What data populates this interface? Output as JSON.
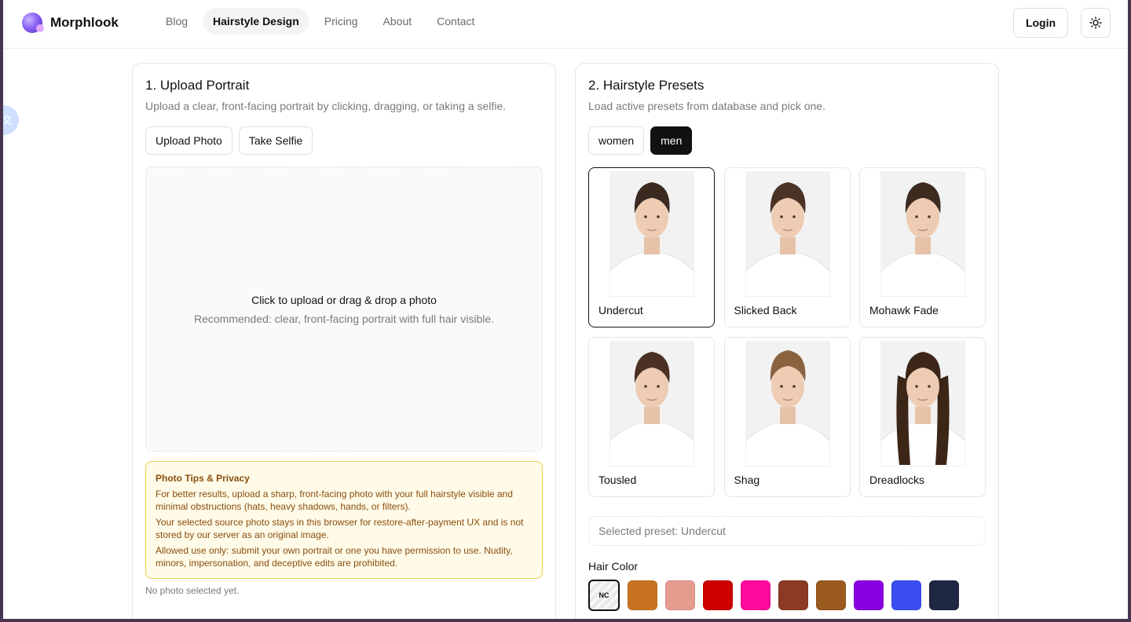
{
  "brand": {
    "name": "Morphlook"
  },
  "nav": {
    "items": [
      {
        "label": "Blog",
        "active": false
      },
      {
        "label": "Hairstyle Design",
        "active": true
      },
      {
        "label": "Pricing",
        "active": false
      },
      {
        "label": "About",
        "active": false
      },
      {
        "label": "Contact",
        "active": false
      }
    ]
  },
  "header": {
    "login_label": "Login",
    "theme_icon": "sun-icon"
  },
  "upload": {
    "title": "1. Upload Portrait",
    "subtitle": "Upload a clear, front-facing portrait by clicking, dragging, or taking a selfie.",
    "upload_button": "Upload Photo",
    "selfie_button": "Take Selfie",
    "drop_main": "Click to upload or drag & drop a photo",
    "drop_sub": "Recommended: clear, front-facing portrait with full hair visible.",
    "tips_title": "Photo Tips & Privacy",
    "tips": [
      "For better results, upload a sharp, front-facing photo with your full hairstyle visible and minimal obstructions (hats, heavy shadows, hands, or filters).",
      "Your selected source photo stays in this browser for restore-after-payment UX and is not stored by our server as an original image.",
      "Allowed use only: submit your own portrait or one you have permission to use. Nudity, minors, impersonation, and deceptive edits are prohibited."
    ],
    "status": "No photo selected yet."
  },
  "presets": {
    "title": "2. Hairstyle Presets",
    "subtitle": "Load active presets from database and pick one.",
    "tabs": [
      {
        "label": "women",
        "active": false
      },
      {
        "label": "men",
        "active": true
      }
    ],
    "items": [
      {
        "label": "Undercut",
        "selected": true,
        "hair": "#3a2a20"
      },
      {
        "label": "Slicked Back",
        "selected": false,
        "hair": "#4a3326"
      },
      {
        "label": "Mohawk Fade",
        "selected": false,
        "hair": "#3d2b20"
      },
      {
        "label": "Tousled",
        "selected": false,
        "hair": "#4a3123"
      },
      {
        "label": "Shag",
        "selected": false,
        "hair": "#8a6240"
      },
      {
        "label": "Dreadlocks",
        "selected": false,
        "hair": "#3b2618"
      }
    ],
    "selected_text": "Selected preset: Undercut",
    "hair_color_title": "Hair Color",
    "colors": [
      {
        "label": "NC",
        "hex": ""
      },
      {
        "label": "",
        "hex": "#c8731f"
      },
      {
        "label": "",
        "hex": "#e59b8e"
      },
      {
        "label": "",
        "hex": "#cc0000"
      },
      {
        "label": "",
        "hex": "#ff0a9c"
      },
      {
        "label": "",
        "hex": "#8b3a23"
      },
      {
        "label": "",
        "hex": "#9a5a1e"
      },
      {
        "label": "",
        "hex": "#8a00e0"
      },
      {
        "label": "",
        "hex": "#3b4ef2"
      },
      {
        "label": "",
        "hex": "#1e2744"
      }
    ]
  }
}
